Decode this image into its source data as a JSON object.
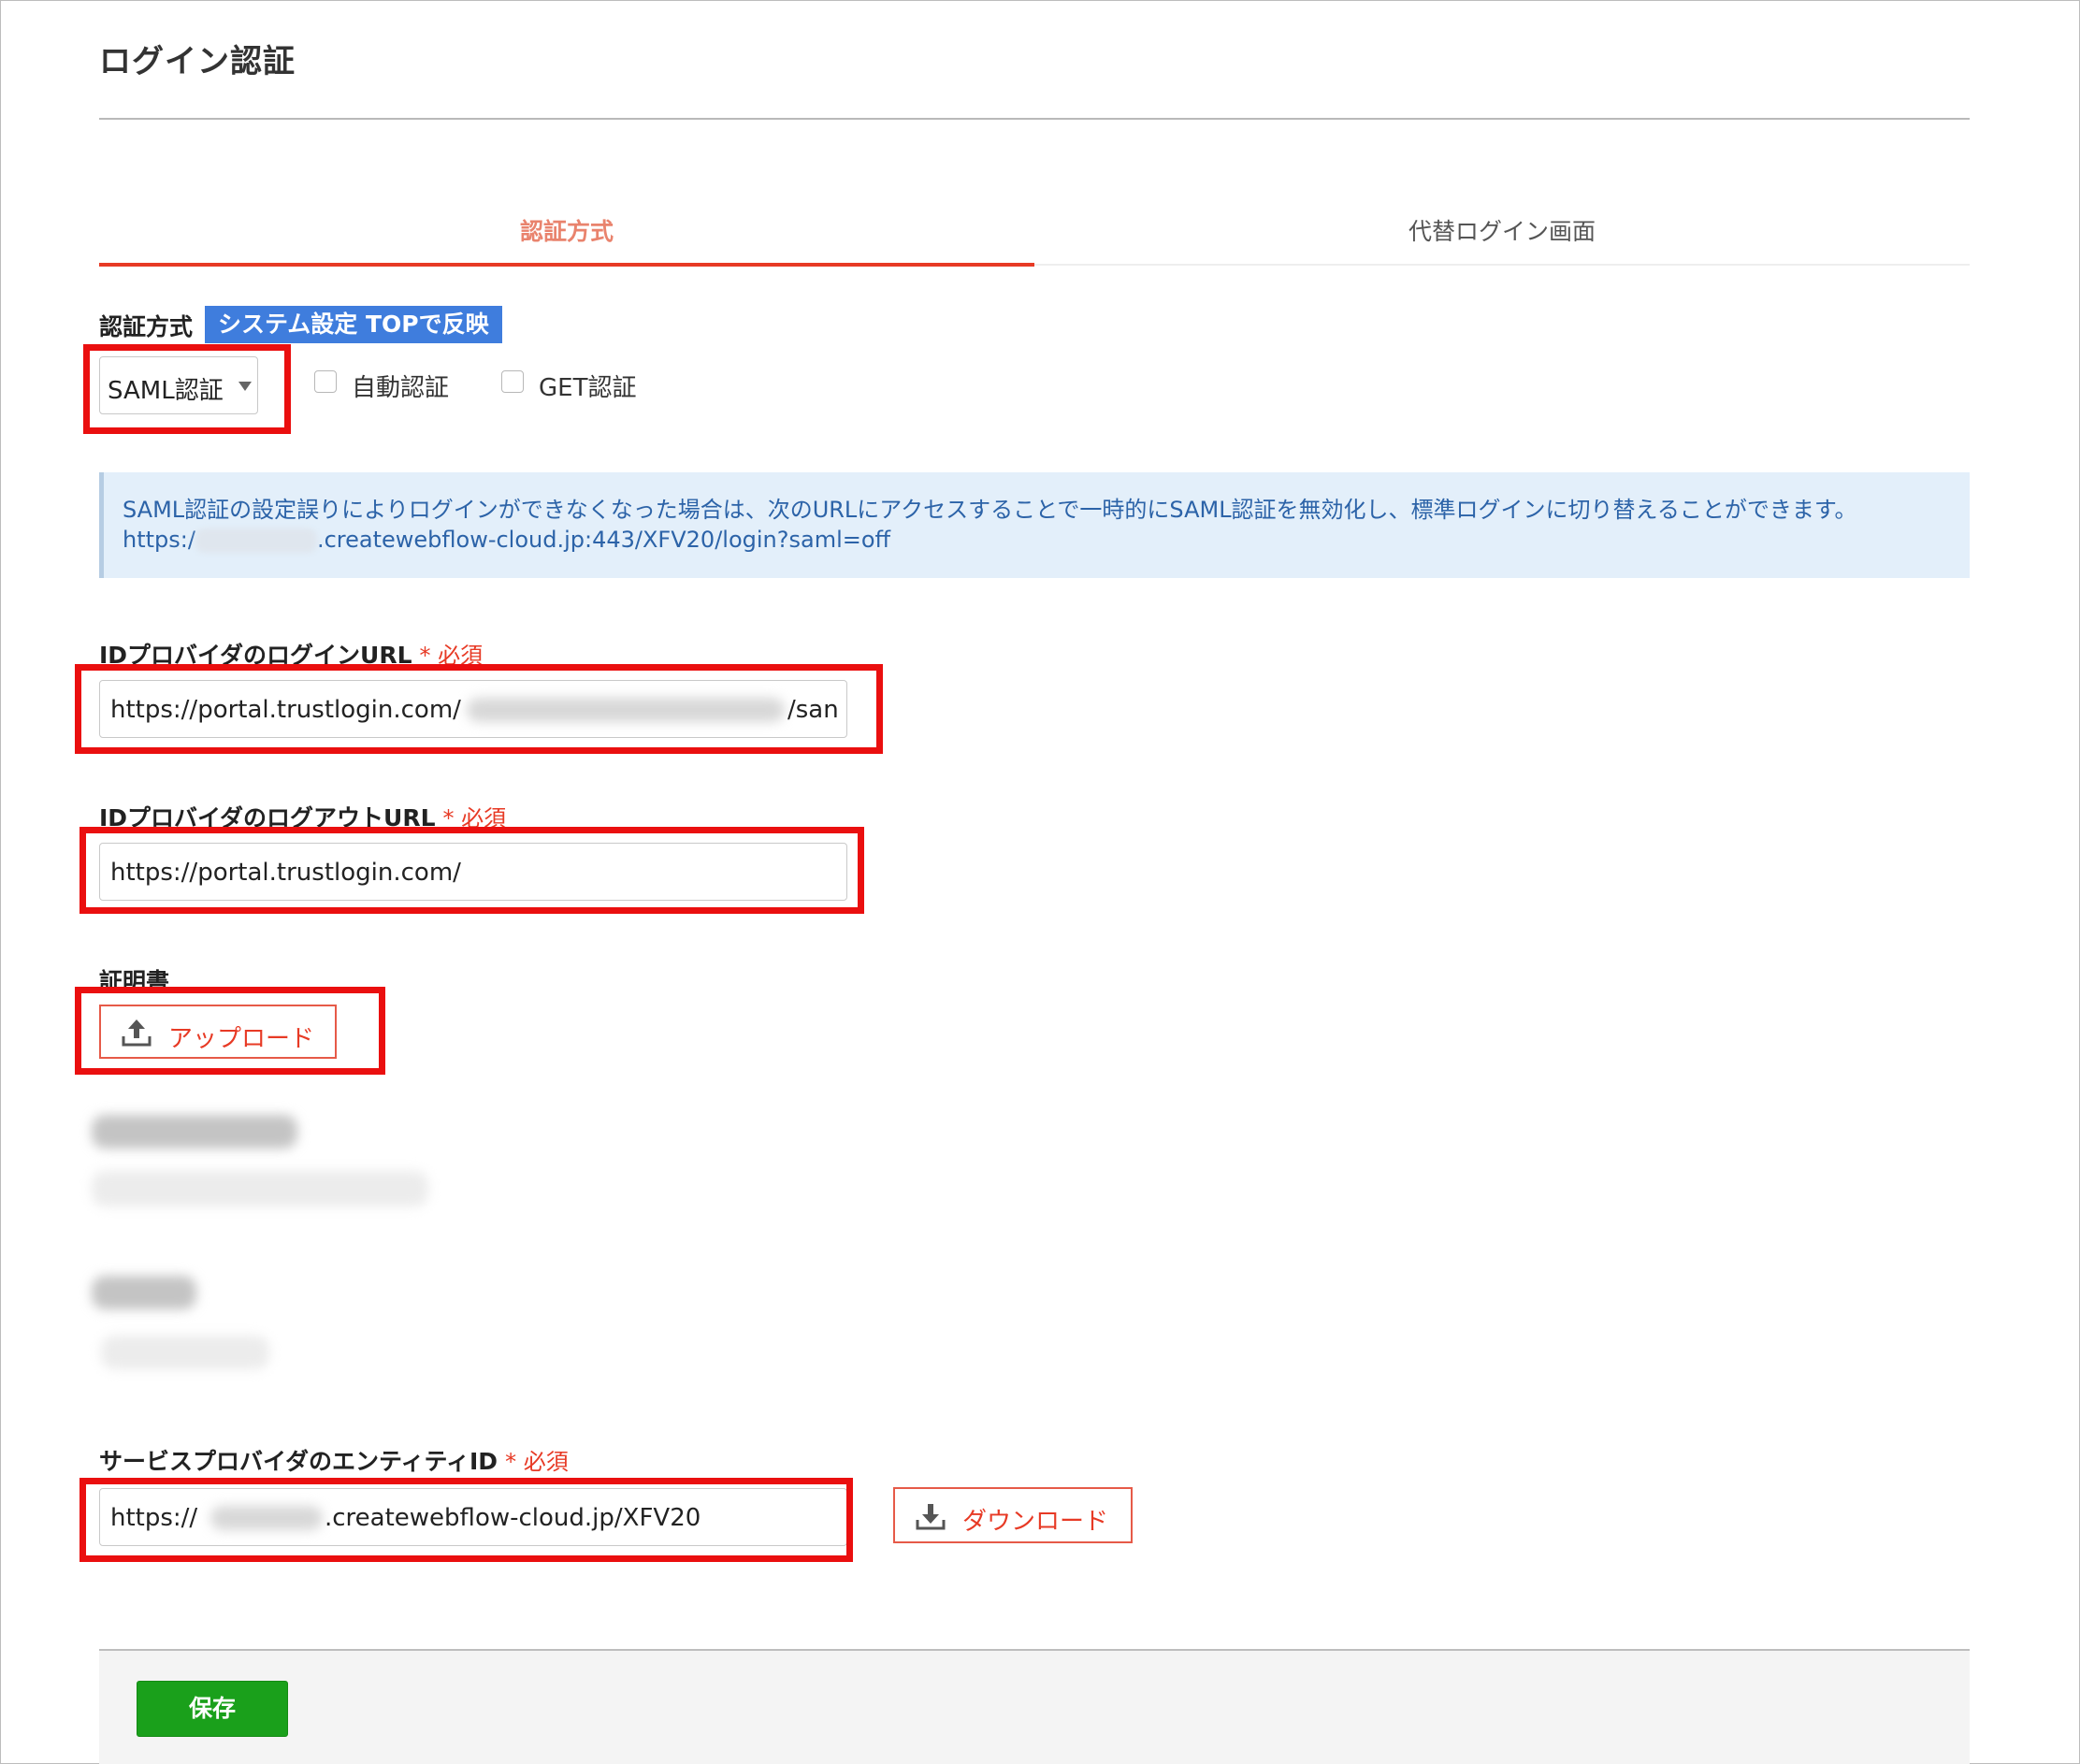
{
  "page": {
    "title": "ログイン認証"
  },
  "tabs": [
    {
      "label": "認証方式",
      "active": true
    },
    {
      "label": "代替ログイン画面",
      "active": false
    }
  ],
  "auth_method": {
    "label": "認証方式",
    "badge": "システム設定 TOPで反映",
    "select_value": "SAML認証",
    "checkboxes": [
      {
        "label": "自動認証",
        "checked": false
      },
      {
        "label": "GET認証",
        "checked": false
      }
    ]
  },
  "notice": {
    "line1": "SAML認証の設定誤りによりログインができなくなった場合は、次のURLにアクセスすることで一時的にSAML認証を無効化し、標準ログインに切り替えることができます。",
    "url_prefix": "https:/",
    "url_suffix": ".createwebflow-cloud.jp:443/XFV20/login?saml=off"
  },
  "idp_login": {
    "label": "IDプロバイダのログインURL",
    "required": "* 必須",
    "value_prefix": "https://portal.trustlogin.com/",
    "value_suffix": "/san"
  },
  "idp_logout": {
    "label": "IDプロバイダのログアウトURL",
    "required": "* 必須",
    "value": "https://portal.trustlogin.com/"
  },
  "certificate": {
    "label": "証明書",
    "upload_label": "アップロード"
  },
  "sp_entity": {
    "label": "サービスプロバイダのエンティティID",
    "required": "* 必須",
    "value_prefix": "https://",
    "value_suffix": ".createwebflow-cloud.jp/XFV20",
    "download_label": "ダウンロード"
  },
  "footer": {
    "save_label": "保存"
  },
  "colors": {
    "accent_red": "#e73a25",
    "badge_blue": "#3f7ddd",
    "notice_bg": "#e3effa",
    "highlight_red": "#ea0f0f",
    "save_green": "#1aa01b"
  }
}
